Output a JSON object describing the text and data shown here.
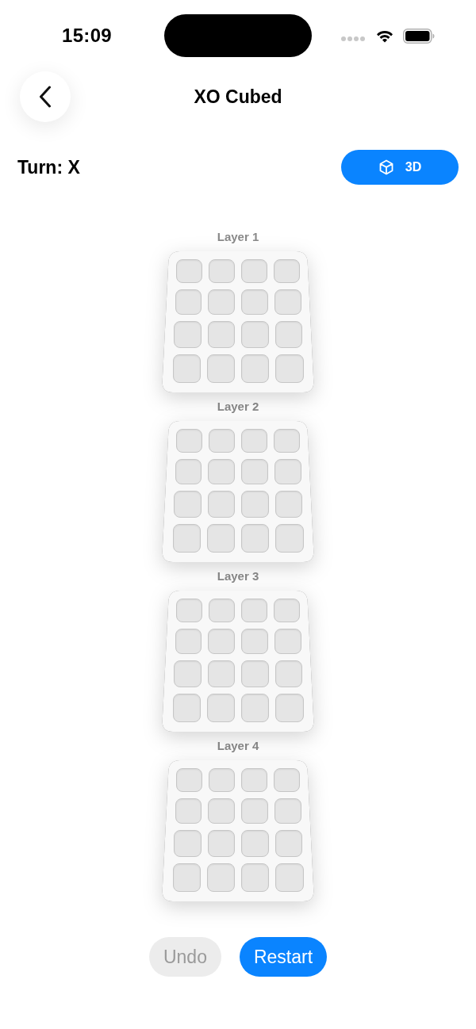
{
  "status_bar": {
    "time": "15:09"
  },
  "nav": {
    "title": "XO Cubed"
  },
  "turn": {
    "label": "Turn: X"
  },
  "view_button": {
    "label": "3D"
  },
  "layers": [
    {
      "label": "Layer 1",
      "cells": [
        [
          {
            "occupied": false
          },
          {
            "occupied": false
          },
          {
            "occupied": false
          },
          {
            "occupied": false
          }
        ],
        [
          {
            "occupied": false
          },
          {
            "occupied": false
          },
          {
            "occupied": false
          },
          {
            "occupied": false
          }
        ],
        [
          {
            "occupied": false
          },
          {
            "occupied": false
          },
          {
            "occupied": false
          },
          {
            "occupied": false
          }
        ],
        [
          {
            "occupied": false
          },
          {
            "occupied": false
          },
          {
            "occupied": false
          },
          {
            "occupied": false
          }
        ]
      ]
    },
    {
      "label": "Layer 2",
      "cells": [
        [
          {
            "occupied": false
          },
          {
            "occupied": false
          },
          {
            "occupied": false
          },
          {
            "occupied": false
          }
        ],
        [
          {
            "occupied": false
          },
          {
            "occupied": false
          },
          {
            "occupied": false
          },
          {
            "occupied": false
          }
        ],
        [
          {
            "occupied": false
          },
          {
            "occupied": false
          },
          {
            "occupied": false
          },
          {
            "occupied": false
          }
        ],
        [
          {
            "occupied": false
          },
          {
            "occupied": false
          },
          {
            "occupied": false
          },
          {
            "occupied": false
          }
        ]
      ]
    },
    {
      "label": "Layer 3",
      "cells": [
        [
          {
            "occupied": false
          },
          {
            "occupied": false
          },
          {
            "occupied": false
          },
          {
            "occupied": false
          }
        ],
        [
          {
            "occupied": false
          },
          {
            "occupied": false
          },
          {
            "occupied": false
          },
          {
            "occupied": false
          }
        ],
        [
          {
            "occupied": false
          },
          {
            "occupied": false
          },
          {
            "occupied": false
          },
          {
            "occupied": false
          }
        ],
        [
          {
            "occupied": false
          },
          {
            "occupied": false
          },
          {
            "occupied": false
          },
          {
            "occupied": false
          }
        ]
      ]
    },
    {
      "label": "Layer 4",
      "cells": [
        [
          {
            "occupied": false
          },
          {
            "occupied": false
          },
          {
            "occupied": false
          },
          {
            "occupied": false
          }
        ],
        [
          {
            "occupied": false
          },
          {
            "occupied": false
          },
          {
            "occupied": false
          },
          {
            "occupied": false
          }
        ],
        [
          {
            "occupied": false
          },
          {
            "occupied": false
          },
          {
            "occupied": false
          },
          {
            "occupied": false
          }
        ],
        [
          {
            "occupied": false
          },
          {
            "occupied": false
          },
          {
            "occupied": false
          },
          {
            "occupied": false
          }
        ]
      ]
    }
  ],
  "actions": [
    {
      "label": "Undo",
      "disabled": true
    },
    {
      "label": "Restart",
      "disabled": false
    }
  ]
}
